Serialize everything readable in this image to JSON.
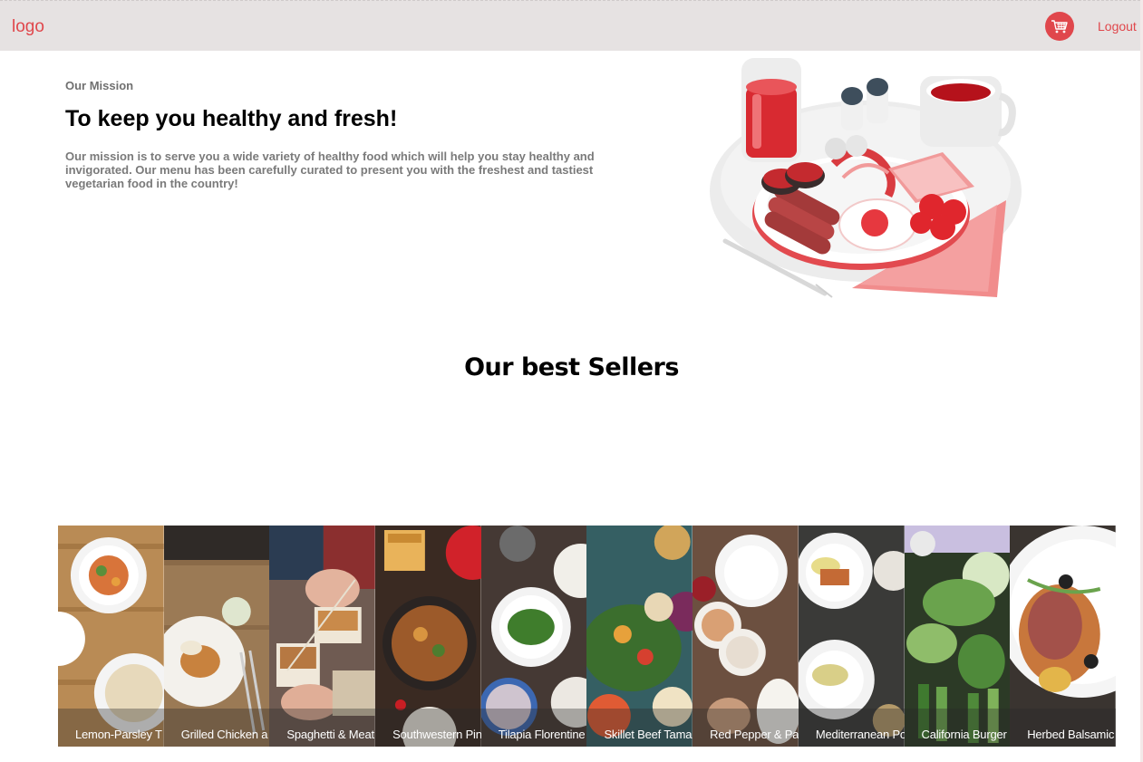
{
  "header": {
    "logo": "logo",
    "logout_label": "Logout",
    "cart_icon": "cart-icon",
    "accent_color": "#e0474c",
    "background_color": "#e6e2e2"
  },
  "mission": {
    "eyebrow": "Our Mission",
    "title": "To keep you healthy and fresh!",
    "text": "Our mission is to serve you a wide variety of healthy food which will help you stay healthy and invigorated. Our menu has been carefully curated to present you with the freshest and tastiest vegetarian food in the country!"
  },
  "best_sellers": {
    "title": "Our best Sellers",
    "items": [
      {
        "label": "Lemon-Parsley T"
      },
      {
        "label": "Grilled Chicken a"
      },
      {
        "label": "Spaghetti & Meat"
      },
      {
        "label": "Southwestern Pin"
      },
      {
        "label": "Tilapia Florentine"
      },
      {
        "label": "Skillet Beef Tama"
      },
      {
        "label": "Red Pepper & Pa"
      },
      {
        "label": "Mediterranean Po"
      },
      {
        "label": "California Burger"
      },
      {
        "label": "Herbed Balsamic"
      }
    ]
  }
}
